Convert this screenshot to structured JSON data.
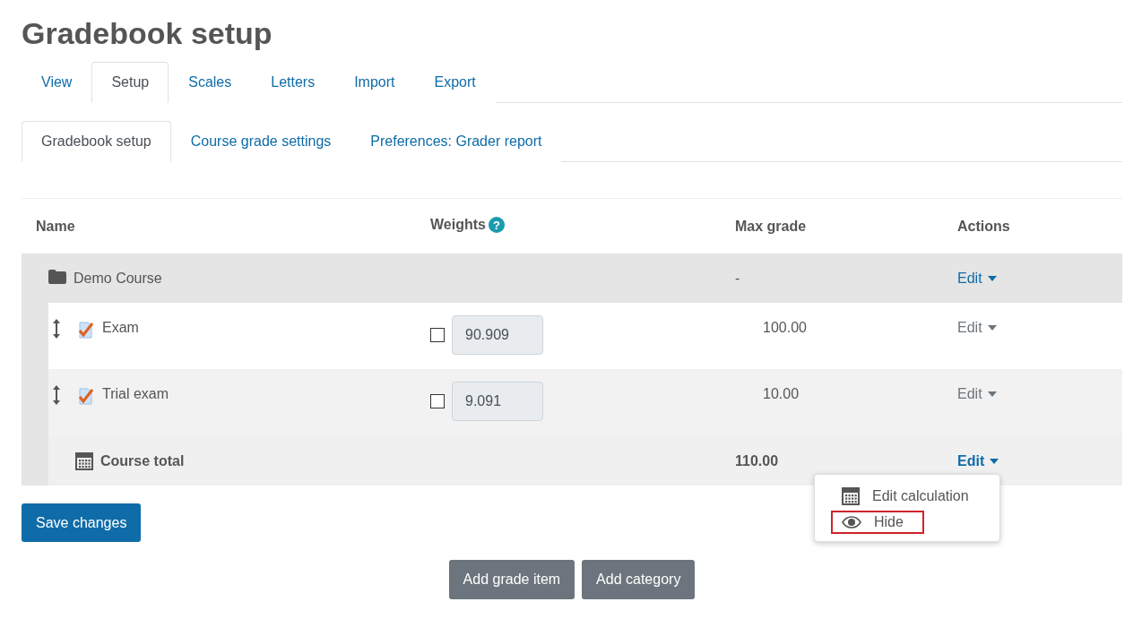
{
  "title": "Gradebook setup",
  "tabs": [
    {
      "label": "View",
      "selected": false
    },
    {
      "label": "Setup",
      "selected": true
    },
    {
      "label": "Scales",
      "selected": false
    },
    {
      "label": "Letters",
      "selected": false
    },
    {
      "label": "Import",
      "selected": false
    },
    {
      "label": "Export",
      "selected": false
    }
  ],
  "subtabs": [
    {
      "label": "Gradebook setup",
      "selected": true
    },
    {
      "label": "Course grade settings",
      "selected": false
    },
    {
      "label": "Preferences: Grader report",
      "selected": false
    }
  ],
  "table": {
    "columns": [
      "Name",
      "Weights",
      "Max grade",
      "Actions"
    ],
    "help_icon": "?",
    "rows": [
      {
        "kind": "category",
        "name": "Demo Course",
        "max_grade": "-",
        "action": "Edit"
      },
      {
        "kind": "item",
        "name": "Exam",
        "weight": "90.909",
        "weight_override": false,
        "max_grade": "100.00",
        "action": "Edit"
      },
      {
        "kind": "item",
        "name": "Trial exam",
        "weight": "9.091",
        "weight_override": false,
        "max_grade": "10.00",
        "action": "Edit"
      },
      {
        "kind": "total",
        "name": "Course total",
        "max_grade": "110.00",
        "action": "Edit"
      }
    ]
  },
  "action_menu": {
    "items": [
      {
        "kind": "calculator",
        "label": "Edit calculation",
        "highlighted": false
      },
      {
        "kind": "eye",
        "label": "Hide",
        "highlighted": true
      }
    ]
  },
  "save_button": "Save changes",
  "buttons": [
    "Add grade item",
    "Add category"
  ]
}
